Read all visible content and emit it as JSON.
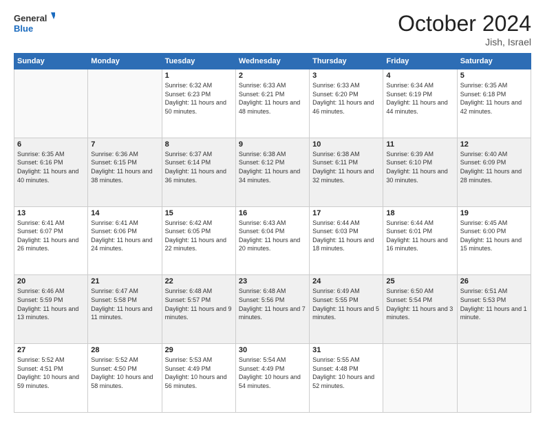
{
  "header": {
    "logo_general": "General",
    "logo_blue": "Blue",
    "month": "October 2024",
    "location": "Jish, Israel"
  },
  "days_of_week": [
    "Sunday",
    "Monday",
    "Tuesday",
    "Wednesday",
    "Thursday",
    "Friday",
    "Saturday"
  ],
  "weeks": [
    [
      {
        "day": "",
        "sunrise": "",
        "sunset": "",
        "daylight": "",
        "empty": true
      },
      {
        "day": "",
        "sunrise": "",
        "sunset": "",
        "daylight": "",
        "empty": true
      },
      {
        "day": "1",
        "sunrise": "Sunrise: 6:32 AM",
        "sunset": "Sunset: 6:23 PM",
        "daylight": "Daylight: 11 hours and 50 minutes."
      },
      {
        "day": "2",
        "sunrise": "Sunrise: 6:33 AM",
        "sunset": "Sunset: 6:21 PM",
        "daylight": "Daylight: 11 hours and 48 minutes."
      },
      {
        "day": "3",
        "sunrise": "Sunrise: 6:33 AM",
        "sunset": "Sunset: 6:20 PM",
        "daylight": "Daylight: 11 hours and 46 minutes."
      },
      {
        "day": "4",
        "sunrise": "Sunrise: 6:34 AM",
        "sunset": "Sunset: 6:19 PM",
        "daylight": "Daylight: 11 hours and 44 minutes."
      },
      {
        "day": "5",
        "sunrise": "Sunrise: 6:35 AM",
        "sunset": "Sunset: 6:18 PM",
        "daylight": "Daylight: 11 hours and 42 minutes."
      }
    ],
    [
      {
        "day": "6",
        "sunrise": "Sunrise: 6:35 AM",
        "sunset": "Sunset: 6:16 PM",
        "daylight": "Daylight: 11 hours and 40 minutes."
      },
      {
        "day": "7",
        "sunrise": "Sunrise: 6:36 AM",
        "sunset": "Sunset: 6:15 PM",
        "daylight": "Daylight: 11 hours and 38 minutes."
      },
      {
        "day": "8",
        "sunrise": "Sunrise: 6:37 AM",
        "sunset": "Sunset: 6:14 PM",
        "daylight": "Daylight: 11 hours and 36 minutes."
      },
      {
        "day": "9",
        "sunrise": "Sunrise: 6:38 AM",
        "sunset": "Sunset: 6:12 PM",
        "daylight": "Daylight: 11 hours and 34 minutes."
      },
      {
        "day": "10",
        "sunrise": "Sunrise: 6:38 AM",
        "sunset": "Sunset: 6:11 PM",
        "daylight": "Daylight: 11 hours and 32 minutes."
      },
      {
        "day": "11",
        "sunrise": "Sunrise: 6:39 AM",
        "sunset": "Sunset: 6:10 PM",
        "daylight": "Daylight: 11 hours and 30 minutes."
      },
      {
        "day": "12",
        "sunrise": "Sunrise: 6:40 AM",
        "sunset": "Sunset: 6:09 PM",
        "daylight": "Daylight: 11 hours and 28 minutes."
      }
    ],
    [
      {
        "day": "13",
        "sunrise": "Sunrise: 6:41 AM",
        "sunset": "Sunset: 6:07 PM",
        "daylight": "Daylight: 11 hours and 26 minutes."
      },
      {
        "day": "14",
        "sunrise": "Sunrise: 6:41 AM",
        "sunset": "Sunset: 6:06 PM",
        "daylight": "Daylight: 11 hours and 24 minutes."
      },
      {
        "day": "15",
        "sunrise": "Sunrise: 6:42 AM",
        "sunset": "Sunset: 6:05 PM",
        "daylight": "Daylight: 11 hours and 22 minutes."
      },
      {
        "day": "16",
        "sunrise": "Sunrise: 6:43 AM",
        "sunset": "Sunset: 6:04 PM",
        "daylight": "Daylight: 11 hours and 20 minutes."
      },
      {
        "day": "17",
        "sunrise": "Sunrise: 6:44 AM",
        "sunset": "Sunset: 6:03 PM",
        "daylight": "Daylight: 11 hours and 18 minutes."
      },
      {
        "day": "18",
        "sunrise": "Sunrise: 6:44 AM",
        "sunset": "Sunset: 6:01 PM",
        "daylight": "Daylight: 11 hours and 16 minutes."
      },
      {
        "day": "19",
        "sunrise": "Sunrise: 6:45 AM",
        "sunset": "Sunset: 6:00 PM",
        "daylight": "Daylight: 11 hours and 15 minutes."
      }
    ],
    [
      {
        "day": "20",
        "sunrise": "Sunrise: 6:46 AM",
        "sunset": "Sunset: 5:59 PM",
        "daylight": "Daylight: 11 hours and 13 minutes."
      },
      {
        "day": "21",
        "sunrise": "Sunrise: 6:47 AM",
        "sunset": "Sunset: 5:58 PM",
        "daylight": "Daylight: 11 hours and 11 minutes."
      },
      {
        "day": "22",
        "sunrise": "Sunrise: 6:48 AM",
        "sunset": "Sunset: 5:57 PM",
        "daylight": "Daylight: 11 hours and 9 minutes."
      },
      {
        "day": "23",
        "sunrise": "Sunrise: 6:48 AM",
        "sunset": "Sunset: 5:56 PM",
        "daylight": "Daylight: 11 hours and 7 minutes."
      },
      {
        "day": "24",
        "sunrise": "Sunrise: 6:49 AM",
        "sunset": "Sunset: 5:55 PM",
        "daylight": "Daylight: 11 hours and 5 minutes."
      },
      {
        "day": "25",
        "sunrise": "Sunrise: 6:50 AM",
        "sunset": "Sunset: 5:54 PM",
        "daylight": "Daylight: 11 hours and 3 minutes."
      },
      {
        "day": "26",
        "sunrise": "Sunrise: 6:51 AM",
        "sunset": "Sunset: 5:53 PM",
        "daylight": "Daylight: 11 hours and 1 minute."
      }
    ],
    [
      {
        "day": "27",
        "sunrise": "Sunrise: 5:52 AM",
        "sunset": "Sunset: 4:51 PM",
        "daylight": "Daylight: 10 hours and 59 minutes."
      },
      {
        "day": "28",
        "sunrise": "Sunrise: 5:52 AM",
        "sunset": "Sunset: 4:50 PM",
        "daylight": "Daylight: 10 hours and 58 minutes."
      },
      {
        "day": "29",
        "sunrise": "Sunrise: 5:53 AM",
        "sunset": "Sunset: 4:49 PM",
        "daylight": "Daylight: 10 hours and 56 minutes."
      },
      {
        "day": "30",
        "sunrise": "Sunrise: 5:54 AM",
        "sunset": "Sunset: 4:49 PM",
        "daylight": "Daylight: 10 hours and 54 minutes."
      },
      {
        "day": "31",
        "sunrise": "Sunrise: 5:55 AM",
        "sunset": "Sunset: 4:48 PM",
        "daylight": "Daylight: 10 hours and 52 minutes."
      },
      {
        "day": "",
        "sunrise": "",
        "sunset": "",
        "daylight": "",
        "empty": true
      },
      {
        "day": "",
        "sunrise": "",
        "sunset": "",
        "daylight": "",
        "empty": true
      }
    ]
  ]
}
